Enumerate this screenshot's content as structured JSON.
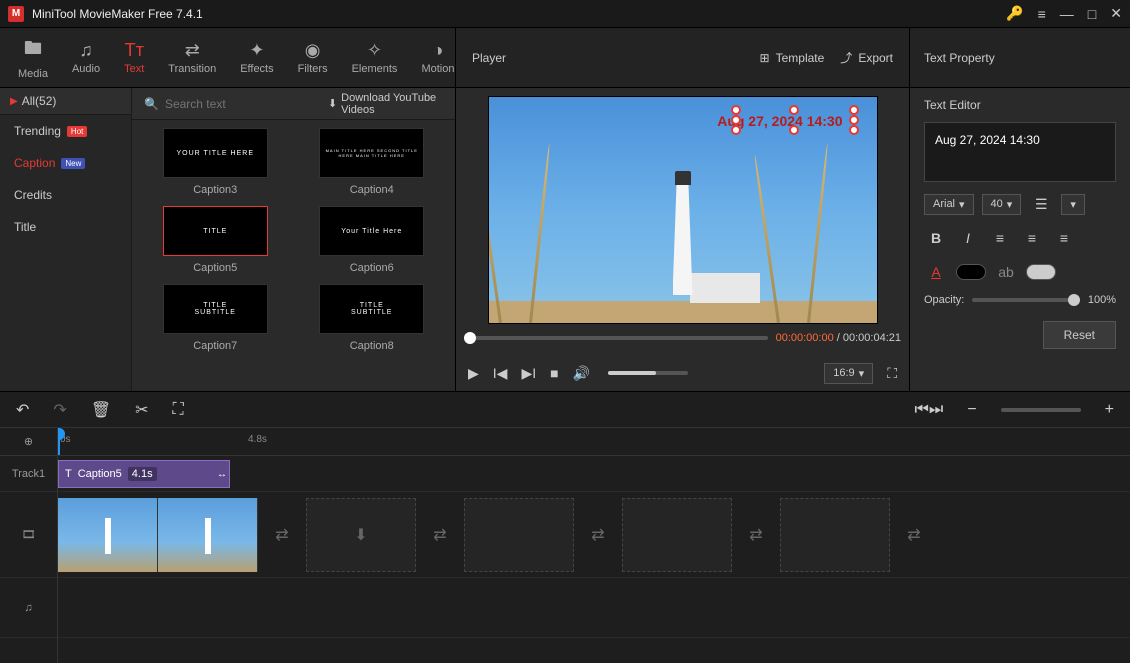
{
  "titlebar": {
    "app_title": "MiniTool MovieMaker Free 7.4.1"
  },
  "toolbar": {
    "items": [
      {
        "label": "Media"
      },
      {
        "label": "Audio"
      },
      {
        "label": "Text"
      },
      {
        "label": "Transition"
      },
      {
        "label": "Effects"
      },
      {
        "label": "Filters"
      },
      {
        "label": "Elements"
      },
      {
        "label": "Motion"
      }
    ]
  },
  "categories": {
    "all_label": "All(52)",
    "items": [
      {
        "label": "Trending",
        "badge": "Hot"
      },
      {
        "label": "Caption",
        "badge": "New"
      },
      {
        "label": "Credits"
      },
      {
        "label": "Title"
      }
    ]
  },
  "search": {
    "placeholder": "Search text"
  },
  "download_link": "Download YouTube Videos",
  "thumbs": [
    {
      "name": "Caption3",
      "text": "YOUR TITLE HERE"
    },
    {
      "name": "Caption4",
      "text": "MAIN TITLE HERE SECOND TITLE HERE MAIN TITLE HERE"
    },
    {
      "name": "Caption5",
      "text": "TITLE"
    },
    {
      "name": "Caption6",
      "text": "Your Title Here"
    },
    {
      "name": "Caption7",
      "text": "TITLE\nSUBTITLE"
    },
    {
      "name": "Caption8",
      "text": "TITLE\nSUBTITLE"
    }
  ],
  "player": {
    "title": "Player",
    "template": "Template",
    "export": "Export",
    "overlay_text": "Aug 27, 2024  14:30",
    "current_time": "00:00:00:00",
    "total_time": "00:00:04:21",
    "aspect": "16:9"
  },
  "text_property": {
    "title": "Text Property",
    "editor_label": "Text Editor",
    "editor_value": "Aug 27, 2024  14:30",
    "font": "Arial",
    "size": "40",
    "opacity_label": "Opacity:",
    "opacity_value": "100%",
    "reset": "Reset"
  },
  "timeline": {
    "ruler": {
      "t0": "0s",
      "t1": "4.8s"
    },
    "track1_label": "Track1",
    "clip": {
      "name": "Caption5",
      "duration": "4.1s"
    }
  }
}
